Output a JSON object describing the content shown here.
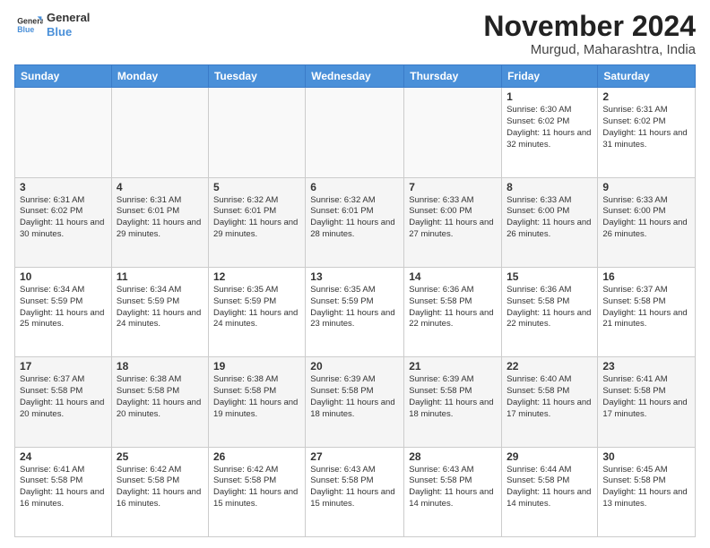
{
  "header": {
    "logo_line1": "General",
    "logo_line2": "Blue",
    "month_title": "November 2024",
    "location": "Murgud, Maharashtra, India"
  },
  "days_of_week": [
    "Sunday",
    "Monday",
    "Tuesday",
    "Wednesday",
    "Thursday",
    "Friday",
    "Saturday"
  ],
  "weeks": [
    [
      {
        "day": "",
        "info": ""
      },
      {
        "day": "",
        "info": ""
      },
      {
        "day": "",
        "info": ""
      },
      {
        "day": "",
        "info": ""
      },
      {
        "day": "",
        "info": ""
      },
      {
        "day": "1",
        "info": "Sunrise: 6:30 AM\nSunset: 6:02 PM\nDaylight: 11 hours and 32 minutes."
      },
      {
        "day": "2",
        "info": "Sunrise: 6:31 AM\nSunset: 6:02 PM\nDaylight: 11 hours and 31 minutes."
      }
    ],
    [
      {
        "day": "3",
        "info": "Sunrise: 6:31 AM\nSunset: 6:02 PM\nDaylight: 11 hours and 30 minutes."
      },
      {
        "day": "4",
        "info": "Sunrise: 6:31 AM\nSunset: 6:01 PM\nDaylight: 11 hours and 29 minutes."
      },
      {
        "day": "5",
        "info": "Sunrise: 6:32 AM\nSunset: 6:01 PM\nDaylight: 11 hours and 29 minutes."
      },
      {
        "day": "6",
        "info": "Sunrise: 6:32 AM\nSunset: 6:01 PM\nDaylight: 11 hours and 28 minutes."
      },
      {
        "day": "7",
        "info": "Sunrise: 6:33 AM\nSunset: 6:00 PM\nDaylight: 11 hours and 27 minutes."
      },
      {
        "day": "8",
        "info": "Sunrise: 6:33 AM\nSunset: 6:00 PM\nDaylight: 11 hours and 26 minutes."
      },
      {
        "day": "9",
        "info": "Sunrise: 6:33 AM\nSunset: 6:00 PM\nDaylight: 11 hours and 26 minutes."
      }
    ],
    [
      {
        "day": "10",
        "info": "Sunrise: 6:34 AM\nSunset: 5:59 PM\nDaylight: 11 hours and 25 minutes."
      },
      {
        "day": "11",
        "info": "Sunrise: 6:34 AM\nSunset: 5:59 PM\nDaylight: 11 hours and 24 minutes."
      },
      {
        "day": "12",
        "info": "Sunrise: 6:35 AM\nSunset: 5:59 PM\nDaylight: 11 hours and 24 minutes."
      },
      {
        "day": "13",
        "info": "Sunrise: 6:35 AM\nSunset: 5:59 PM\nDaylight: 11 hours and 23 minutes."
      },
      {
        "day": "14",
        "info": "Sunrise: 6:36 AM\nSunset: 5:58 PM\nDaylight: 11 hours and 22 minutes."
      },
      {
        "day": "15",
        "info": "Sunrise: 6:36 AM\nSunset: 5:58 PM\nDaylight: 11 hours and 22 minutes."
      },
      {
        "day": "16",
        "info": "Sunrise: 6:37 AM\nSunset: 5:58 PM\nDaylight: 11 hours and 21 minutes."
      }
    ],
    [
      {
        "day": "17",
        "info": "Sunrise: 6:37 AM\nSunset: 5:58 PM\nDaylight: 11 hours and 20 minutes."
      },
      {
        "day": "18",
        "info": "Sunrise: 6:38 AM\nSunset: 5:58 PM\nDaylight: 11 hours and 20 minutes."
      },
      {
        "day": "19",
        "info": "Sunrise: 6:38 AM\nSunset: 5:58 PM\nDaylight: 11 hours and 19 minutes."
      },
      {
        "day": "20",
        "info": "Sunrise: 6:39 AM\nSunset: 5:58 PM\nDaylight: 11 hours and 18 minutes."
      },
      {
        "day": "21",
        "info": "Sunrise: 6:39 AM\nSunset: 5:58 PM\nDaylight: 11 hours and 18 minutes."
      },
      {
        "day": "22",
        "info": "Sunrise: 6:40 AM\nSunset: 5:58 PM\nDaylight: 11 hours and 17 minutes."
      },
      {
        "day": "23",
        "info": "Sunrise: 6:41 AM\nSunset: 5:58 PM\nDaylight: 11 hours and 17 minutes."
      }
    ],
    [
      {
        "day": "24",
        "info": "Sunrise: 6:41 AM\nSunset: 5:58 PM\nDaylight: 11 hours and 16 minutes."
      },
      {
        "day": "25",
        "info": "Sunrise: 6:42 AM\nSunset: 5:58 PM\nDaylight: 11 hours and 16 minutes."
      },
      {
        "day": "26",
        "info": "Sunrise: 6:42 AM\nSunset: 5:58 PM\nDaylight: 11 hours and 15 minutes."
      },
      {
        "day": "27",
        "info": "Sunrise: 6:43 AM\nSunset: 5:58 PM\nDaylight: 11 hours and 15 minutes."
      },
      {
        "day": "28",
        "info": "Sunrise: 6:43 AM\nSunset: 5:58 PM\nDaylight: 11 hours and 14 minutes."
      },
      {
        "day": "29",
        "info": "Sunrise: 6:44 AM\nSunset: 5:58 PM\nDaylight: 11 hours and 14 minutes."
      },
      {
        "day": "30",
        "info": "Sunrise: 6:45 AM\nSunset: 5:58 PM\nDaylight: 11 hours and 13 minutes."
      }
    ]
  ]
}
